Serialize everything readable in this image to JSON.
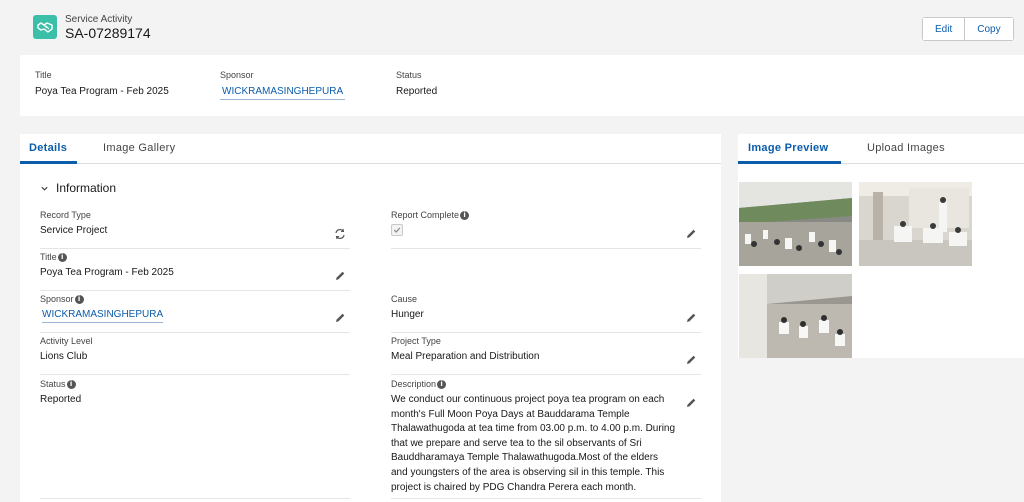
{
  "header": {
    "object_label": "Service Activity",
    "record_name": "SA-07289174",
    "buttons": [
      "Edit",
      "Copy"
    ]
  },
  "highlights": {
    "title_label": "Title",
    "title_value": "Poya Tea Program - Feb 2025",
    "sponsor_label": "Sponsor",
    "sponsor_value": "WICKRAMASINGHEPURA",
    "status_label": "Status",
    "status_value": "Reported"
  },
  "main_tabs": [
    "Details",
    "Image Gallery"
  ],
  "section_title": "Information",
  "fields": {
    "record_type": {
      "label": "Record Type",
      "value": "Service Project"
    },
    "report_complete": {
      "label": "Report Complete",
      "checked": true
    },
    "title": {
      "label": "Title",
      "value": "Poya Tea Program - Feb 2025"
    },
    "sponsor": {
      "label": "Sponsor",
      "value": "WICKRAMASINGHEPURA"
    },
    "cause": {
      "label": "Cause",
      "value": "Hunger"
    },
    "activity_level": {
      "label": "Activity Level",
      "value": "Lions Club"
    },
    "project_type": {
      "label": "Project Type",
      "value": "Meal Preparation and Distribution"
    },
    "status": {
      "label": "Status",
      "value": "Reported"
    },
    "description": {
      "label": "Description",
      "value": "We conduct our continuous project poya tea program on each month's Full Moon Poya Days at Bauddarama Temple Thalawathugoda at tea time from 03.00 p.m. to 4.00 p.m. During that we prepare and serve tea to the sil observants of Sri Bauddharamaya Temple Thalawathugoda.Most of the elders and youngsters of the area is observing sil in this temple. This project is chaired by PDG Chandra Perera each month."
    }
  },
  "side_tabs": [
    "Image Preview",
    "Upload Images"
  ],
  "colors": {
    "brand_blue": "#0b5cab",
    "record_icon": "#3bbfa8",
    "page_bg": "#f3f3f3"
  },
  "icons": [
    "handshake-icon",
    "pencil-icon",
    "record-type-change-icon",
    "info-icon",
    "chevron-down-icon",
    "checkmark-icon"
  ]
}
